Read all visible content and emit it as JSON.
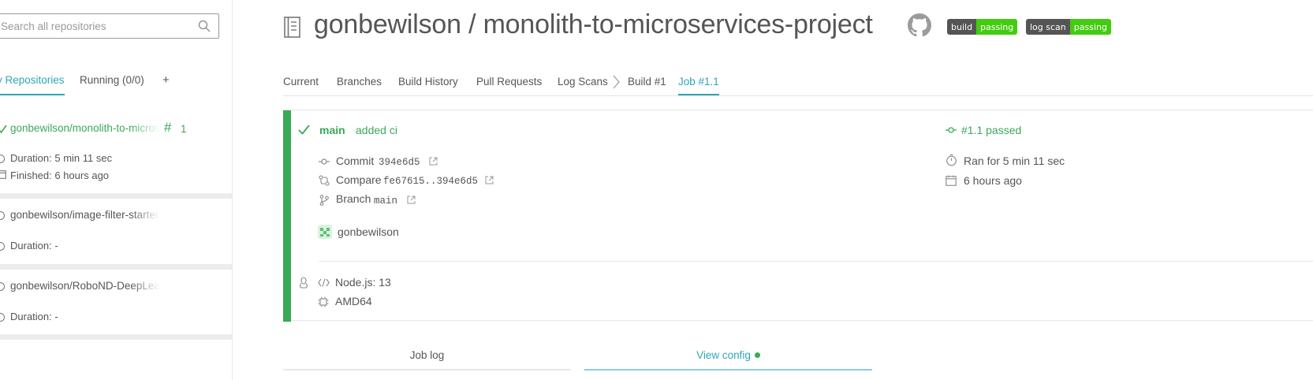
{
  "sidebar": {
    "search_placeholder": "Search all repositories",
    "tabs": {
      "repositories": "y Repositories",
      "running": "Running (0/0)",
      "add": "+"
    },
    "repos": [
      {
        "name": "gonbewilson/monolith-to-microservices-project",
        "hash": "#",
        "build_number": "1",
        "duration": "Duration: 5 min 11 sec",
        "finished": "Finished: 6 hours ago"
      },
      {
        "name": "gonbewilson/image-filter-starter-code",
        "duration": "Duration: -"
      },
      {
        "name": "gonbewilson/RoboND-DeepLearning-Project",
        "duration": "Duration: -"
      }
    ]
  },
  "header": {
    "title": "gonbewilson / monolith-to-microservices-project",
    "badges": [
      {
        "label": "build",
        "status": "passing"
      },
      {
        "label": "log scan",
        "status": "passing"
      }
    ]
  },
  "tabs": [
    "Current",
    "Branches",
    "Build History",
    "Pull Requests",
    "Log Scans",
    "Build #1",
    "Job #1.1"
  ],
  "job": {
    "branch": "main",
    "message": "added ci",
    "status": "#1.1 passed",
    "commit_label": "Commit",
    "commit": "394e6d5",
    "compare_label": "Compare",
    "compare": "fe67615..394e6d5",
    "branch_label": "Branch",
    "branch_value": "main",
    "author": "gonbewilson",
    "ran_for": "Ran for 5 min 11 sec",
    "finished": "6 hours ago",
    "language": "Node.js: 13",
    "arch": "AMD64"
  },
  "bottom_tabs": {
    "job_log": "Job log",
    "view_config": "View config"
  },
  "colors": {
    "accent": "#2fa6b8",
    "passed": "#39aa56",
    "badge_passing": "#4c1"
  }
}
